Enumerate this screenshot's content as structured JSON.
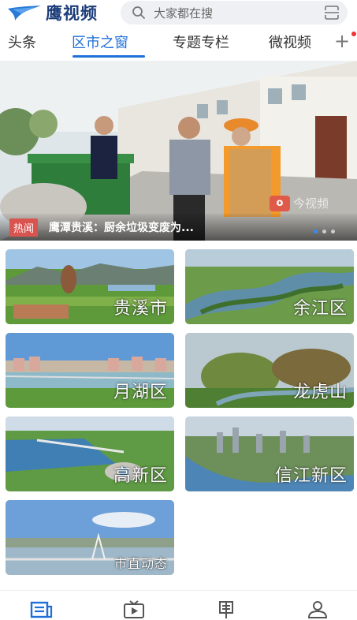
{
  "header": {
    "app_name": "鹰视频",
    "search_placeholder": "大家都在搜"
  },
  "tabs": [
    {
      "label": "头条",
      "active": false
    },
    {
      "label": "区市之窗",
      "active": true
    },
    {
      "label": "专题专栏",
      "active": false
    },
    {
      "label": "微视频",
      "active": false
    }
  ],
  "banner": {
    "tag": "热闻",
    "caption": "鹰潭贵溪：厨余垃圾变废为...",
    "watermark": "今视频",
    "slide_count": 3,
    "active_slide": 1
  },
  "tiles": [
    {
      "label": "贵溪市"
    },
    {
      "label": "余江区"
    },
    {
      "label": "月湖区"
    },
    {
      "label": "龙虎山"
    },
    {
      "label": "高新区"
    },
    {
      "label": "信江新区"
    },
    {
      "label": "市直动态"
    }
  ],
  "bottom_nav": [
    {
      "icon": "news-icon",
      "active": true
    },
    {
      "icon": "video-icon",
      "active": false
    },
    {
      "icon": "column-icon",
      "active": false
    },
    {
      "icon": "profile-icon",
      "active": false
    }
  ],
  "colors": {
    "accent": "#1f6fd8",
    "tag_red": "#d9534f",
    "logo_blue": "#1c3d7a"
  }
}
